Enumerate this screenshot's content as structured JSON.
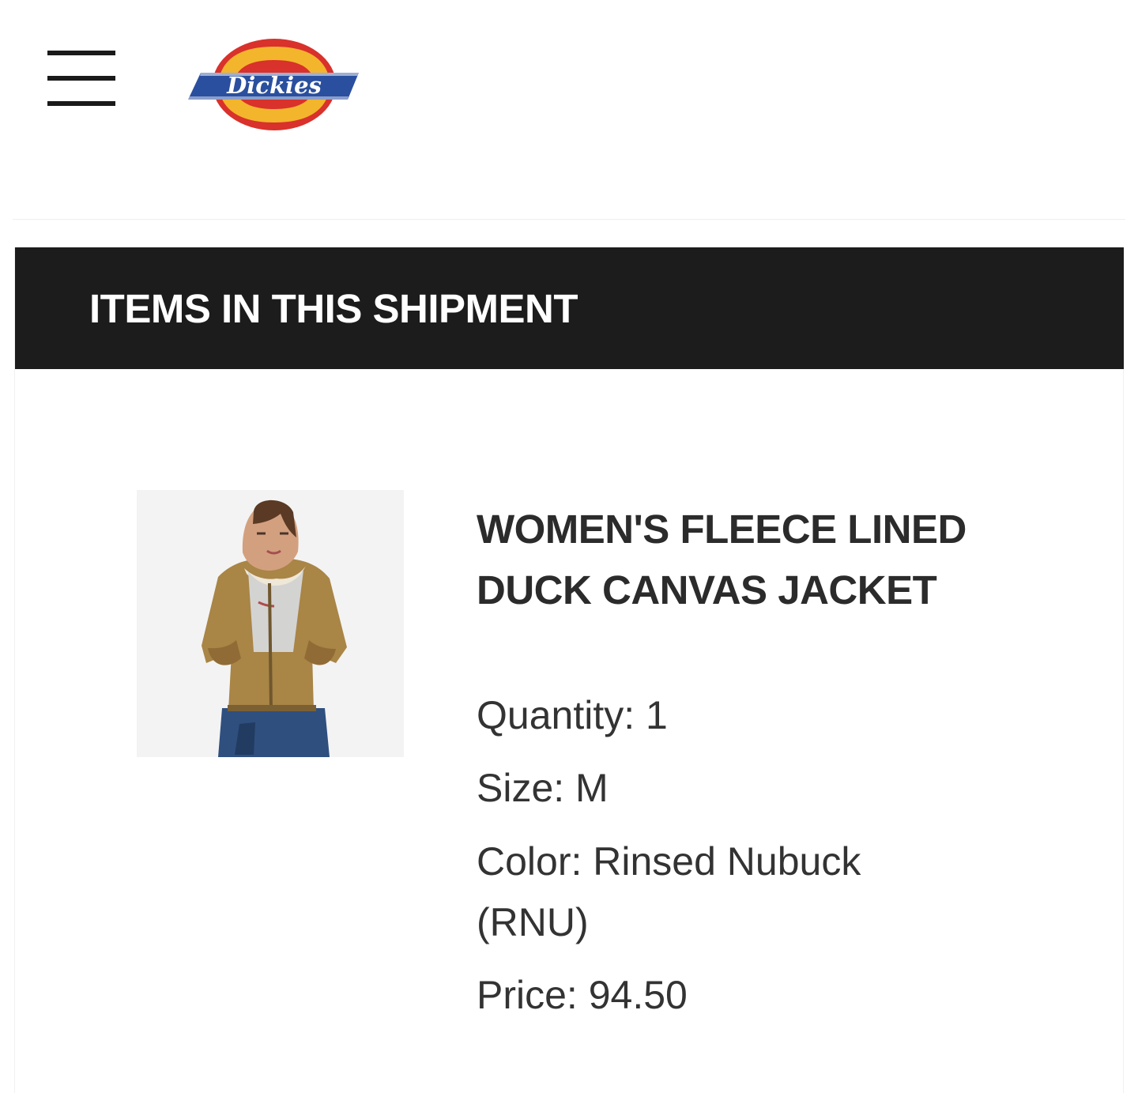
{
  "header": {
    "logo_text": "Dickies",
    "menu_icon": "hamburger-menu-icon"
  },
  "shipment": {
    "title": "ITEMS IN THIS SHIPMENT",
    "items": [
      {
        "name": "WOMEN'S FLEECE LINED DUCK CANVAS JACKET",
        "quantity": "Quantity: 1",
        "size": "Size: M",
        "color": "Color: Rinsed Nubuck (RNU)",
        "price": "Price: 94.50"
      }
    ]
  },
  "colors": {
    "shipment_bar": "#1c1c1c",
    "shipment_bar_text": "#ffffff",
    "product_text": "#2b2b2b",
    "logo_red": "#d9312b",
    "logo_yellow": "#f3b52c",
    "logo_blue": "#2a4f9e"
  }
}
